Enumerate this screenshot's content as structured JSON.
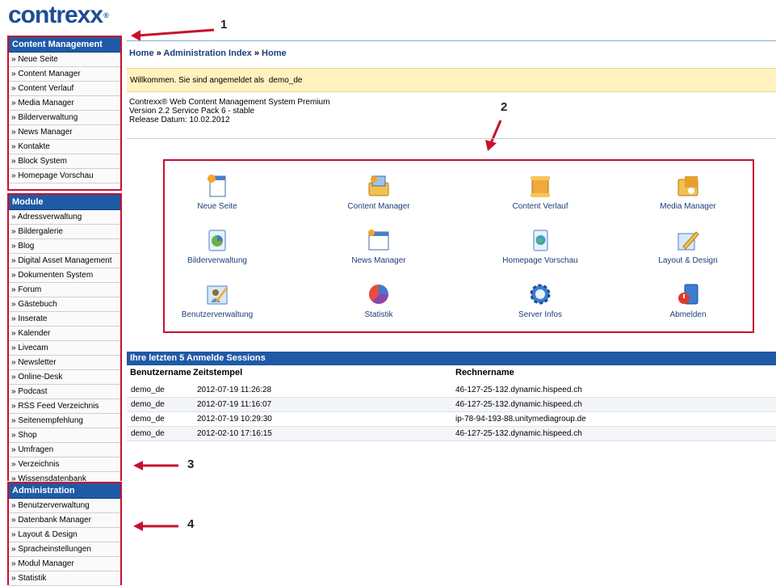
{
  "logo": {
    "text": "contrexx",
    "reg": "®"
  },
  "sidebar": {
    "content_management": {
      "title": "Content Management",
      "items": [
        "» Neue Seite",
        "» Content Manager",
        "» Content Verlauf",
        "» Media Manager",
        "» Bilderverwaltung",
        "» News Manager",
        "» Kontakte",
        "» Block System",
        "» Homepage Vorschau"
      ]
    },
    "module": {
      "title": "Module",
      "items": [
        "» Adressverwaltung",
        "» Bildergalerie",
        "» Blog",
        "» Digital Asset Management",
        "» Dokumenten System",
        "» Forum",
        "» Gästebuch",
        "» Inserate",
        "» Kalender",
        "» Livecam",
        "» Newsletter",
        "» Online-Desk",
        "» Podcast",
        "» RSS Feed Verzeichnis",
        "» Seitenempfehlung",
        "» Shop",
        "» Umfragen",
        "» Verzeichnis",
        "» Wissensdatenbank"
      ]
    },
    "administration": {
      "title": "Administration",
      "items": [
        "» Benutzerverwaltung",
        "» Datenbank Manager",
        "» Layout & Design",
        "» Spracheinstellungen",
        "» Modul Manager",
        "» Statistik"
      ]
    }
  },
  "annotations": {
    "a1": "1",
    "a2": "2",
    "a3": "3",
    "a4": "4"
  },
  "breadcrumb": {
    "home": "Home",
    "admin": "Administration Index",
    "current": "Home",
    "sep": " » "
  },
  "welcome": {
    "text": "Willkommen. Sie sind angemeldet als",
    "user": "demo_de"
  },
  "version": {
    "line1": "Contrexx® Web Content Management System Premium",
    "line2": "Version 2.2 Service Pack 6 - stable",
    "line3": "Release Datum: 10.02.2012"
  },
  "tiles": [
    {
      "label": "Neue Seite",
      "icon": "new-page-icon"
    },
    {
      "label": "Content Manager",
      "icon": "content-manager-icon"
    },
    {
      "label": "Content Verlauf",
      "icon": "content-history-icon"
    },
    {
      "label": "Media Manager",
      "icon": "media-manager-icon"
    },
    {
      "label": "Bilderverwaltung",
      "icon": "image-management-icon"
    },
    {
      "label": "News Manager",
      "icon": "news-manager-icon"
    },
    {
      "label": "Homepage Vorschau",
      "icon": "homepage-preview-icon"
    },
    {
      "label": "Layout & Design",
      "icon": "layout-design-icon"
    },
    {
      "label": "Benutzerverwaltung",
      "icon": "user-management-icon"
    },
    {
      "label": "Statistik",
      "icon": "statistics-icon"
    },
    {
      "label": "Server Infos",
      "icon": "server-info-icon"
    },
    {
      "label": "Abmelden",
      "icon": "logout-icon"
    }
  ],
  "sessions": {
    "title": "Ihre letzten 5 Anmelde Sessions",
    "columns": [
      "Benutzername",
      "Zeitstempel",
      "Rechnername"
    ],
    "rows": [
      [
        "demo_de",
        "2012-07-19 11:26:28",
        "46-127-25-132.dynamic.hispeed.ch"
      ],
      [
        "demo_de",
        "2012-07-19 11:16:07",
        "46-127-25-132.dynamic.hispeed.ch"
      ],
      [
        "demo_de",
        "2012-07-19 10:29:30",
        "ip-78-94-193-88.unitymediagroup.de"
      ],
      [
        "demo_de",
        "2012-02-10 17:16:15",
        "46-127-25-132.dynamic.hispeed.ch"
      ]
    ]
  },
  "colors": {
    "accent": "#1f5aa6",
    "annotation": "#c8102e",
    "welcome_bg": "#fff2c0"
  }
}
